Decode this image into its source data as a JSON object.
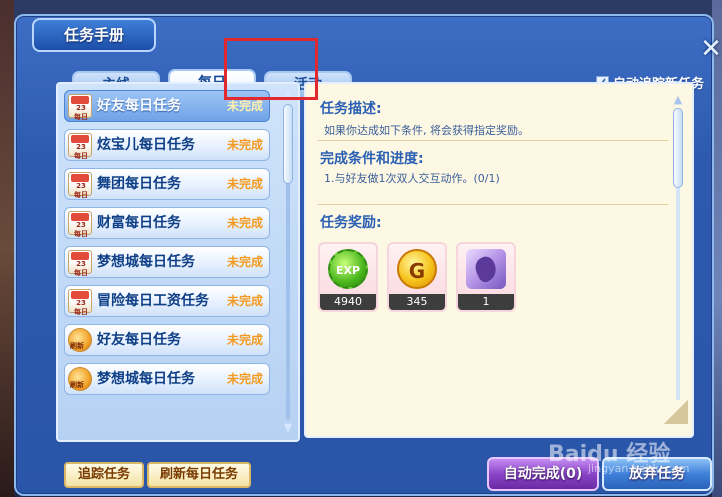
{
  "window": {
    "title": "任务手册"
  },
  "tabs": [
    {
      "label": "主线"
    },
    {
      "label": "每日"
    },
    {
      "label": "活动"
    }
  ],
  "auto_track": {
    "label": "自动追踪新任务",
    "checked": true,
    "check_mark": "✓"
  },
  "close_glyph": "✕",
  "task_list": [
    {
      "name": "好友每日任务",
      "status": "未完成",
      "icon": "calendar-icon",
      "icon_text": "23 每日",
      "selected": true
    },
    {
      "name": "炫宝儿每日任务",
      "status": "未完成",
      "icon": "calendar-icon",
      "icon_text": "23 每日"
    },
    {
      "name": "舞团每日任务",
      "status": "未完成",
      "icon": "calendar-icon",
      "icon_text": "23 每日"
    },
    {
      "name": "财富每日任务",
      "status": "未完成",
      "icon": "calendar-icon",
      "icon_text": "23 每日"
    },
    {
      "name": "梦想城每日任务",
      "status": "未完成",
      "icon": "calendar-icon",
      "icon_text": "23 每日"
    },
    {
      "name": "冒险每日工资任务",
      "status": "未完成",
      "icon": "calendar-icon",
      "icon_text": "23 每日"
    },
    {
      "name": "好友每日任务",
      "status": "未完成",
      "icon": "refresh-icon",
      "icon_text": "刷新"
    },
    {
      "name": "梦想城每日任务",
      "status": "未完成",
      "icon": "refresh-icon",
      "icon_text": "刷新"
    }
  ],
  "detail": {
    "desc_title": "任务描述:",
    "desc_text": "如果你达成如下条件, 将会获得指定奖励。",
    "cond_title": "完成条件和进度:",
    "cond_text": "1.与好友做1次双人交互动作。(0/1)",
    "reward_title": "任务奖励:",
    "rewards": [
      {
        "icon": "exp-icon",
        "label": "EXP",
        "qty": "4940"
      },
      {
        "icon": "gold-icon",
        "label": "G",
        "qty": "345"
      },
      {
        "icon": "item-icon",
        "label": "",
        "qty": "1"
      }
    ]
  },
  "buttons": {
    "track": "追踪任务",
    "refresh": "刷新每日任务",
    "auto_complete": "自动完成(0)",
    "abandon": "放弃任务"
  },
  "watermark": {
    "main": "Baidu 经验",
    "sub": "jingyan.baidu.com"
  },
  "colors": {
    "highlight_box": "#e1282e",
    "status": "#f29b20"
  }
}
